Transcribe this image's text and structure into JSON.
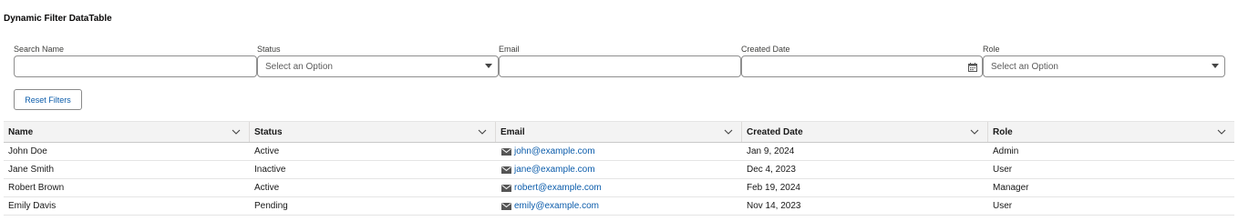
{
  "card": {
    "title": "Dynamic Filter DataTable"
  },
  "filters": {
    "search_name": {
      "label": "Search Name",
      "value": "",
      "placeholder": ""
    },
    "status": {
      "label": "Status",
      "placeholder": "Select an Option"
    },
    "email": {
      "label": "Email",
      "value": "",
      "placeholder": ""
    },
    "created_date": {
      "label": "Created Date",
      "value": "",
      "icon": "calendar-icon"
    },
    "role": {
      "label": "Role",
      "placeholder": "Select an Option"
    }
  },
  "reset_button": {
    "label": "Reset Filters"
  },
  "table": {
    "columns": [
      "Name",
      "Status",
      "Email",
      "Created Date",
      "Role"
    ],
    "rows": [
      {
        "name": "John Doe",
        "status": "Active",
        "email": "john@example.com",
        "created": "Jan 9, 2024",
        "role": "Admin"
      },
      {
        "name": "Jane Smith",
        "status": "Inactive",
        "email": "jane@example.com",
        "created": "Dec 4, 2023",
        "role": "User"
      },
      {
        "name": "Robert Brown",
        "status": "Active",
        "email": "robert@example.com",
        "created": "Feb 19, 2024",
        "role": "Manager"
      },
      {
        "name": "Emily Davis",
        "status": "Pending",
        "email": "emily@example.com",
        "created": "Nov 14, 2023",
        "role": "User"
      }
    ]
  },
  "colors": {
    "link": "#0b5cab",
    "header_bg": "#f3f3f3",
    "border": "#8e8e8e"
  }
}
